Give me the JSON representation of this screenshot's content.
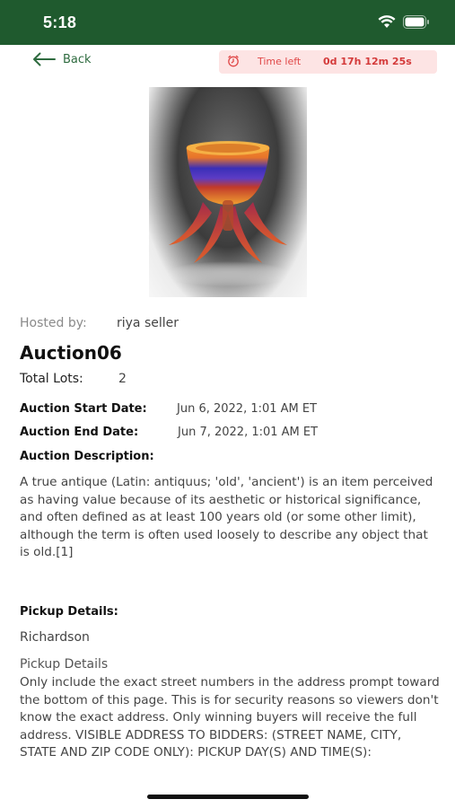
{
  "status_bar": {
    "time": "5:18",
    "icons": [
      "wifi-icon",
      "battery-icon"
    ]
  },
  "nav": {
    "back_label": "Back",
    "timer_label": "Time left",
    "timer_value": "0d 17h 12m 25s"
  },
  "auction": {
    "hosted_label": "Hosted by:",
    "host_name": "riya seller",
    "title": "Auction06",
    "total_lots_label": "Total Lots:",
    "total_lots_value": "2",
    "start_label": "Auction Start Date:",
    "start_value": "Jun 6, 2022, 1:01 AM ET",
    "end_label": "Auction End Date:",
    "end_value": "Jun 7, 2022, 1:01 AM ET",
    "description_label": "Auction Description:",
    "description_text": "A true antique (Latin: antiquus; 'old', 'ancient') is an item perceived as having value because of its aesthetic or historical significance, and often defined as at least 100 years old (or some other limit), although the term is often used loosely to describe any object that is old.[1]",
    "pickup_label": "Pickup Details:",
    "pickup_city": "Richardson",
    "pickup_details_heading": "Pickup Details",
    "pickup_details_text": "Only include the exact street numbers in the address prompt toward the bottom of this page. This is for security reasons so viewers don't know the exact address. Only winning buyers will receive the full address. VISIBLE ADDRESS TO BIDDERS: (STREET NAME, CITY, STATE AND ZIP CODE ONLY): PICKUP DAY(S) AND TIME(S):"
  },
  "colors": {
    "header_green": "#1f5a2e",
    "back_green": "#2e6b3f",
    "timer_bg": "#fde4e4",
    "timer_red": "#d43a3a"
  }
}
